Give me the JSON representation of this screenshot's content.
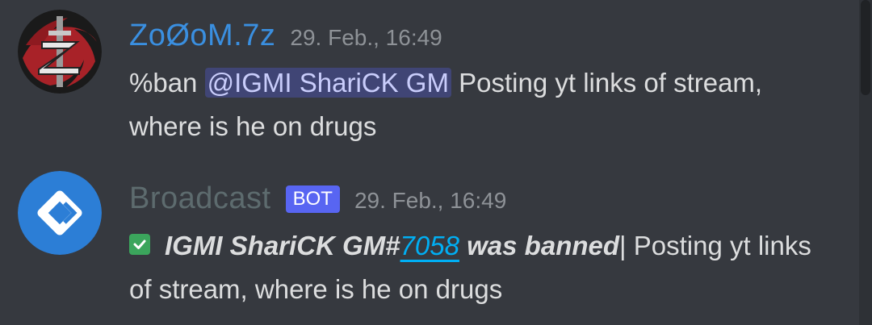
{
  "messages": [
    {
      "username": "ZoØoM.7z",
      "timestamp": "29. Feb., 16:49",
      "text_prefix": "%ban ",
      "mention": "@IGMI ShariCK GM",
      "text_suffix": " Posting yt links of stream, where is he on drugs",
      "avatar_letter": "Z",
      "colors": {
        "username": "#3a8fe0"
      }
    },
    {
      "username": "Broadcast",
      "badge": "BOT",
      "timestamp": "29. Feb., 16:49",
      "ban_name": "IGMI ShariCK GM#",
      "ban_discriminator": "7058",
      "ban_suffix": " was banned",
      "reason": "| Posting yt links of stream, where is he on drugs",
      "colors": {
        "username": "#5d6b6e",
        "badge": "#5865f2",
        "check": "#3ba55c"
      }
    }
  ]
}
